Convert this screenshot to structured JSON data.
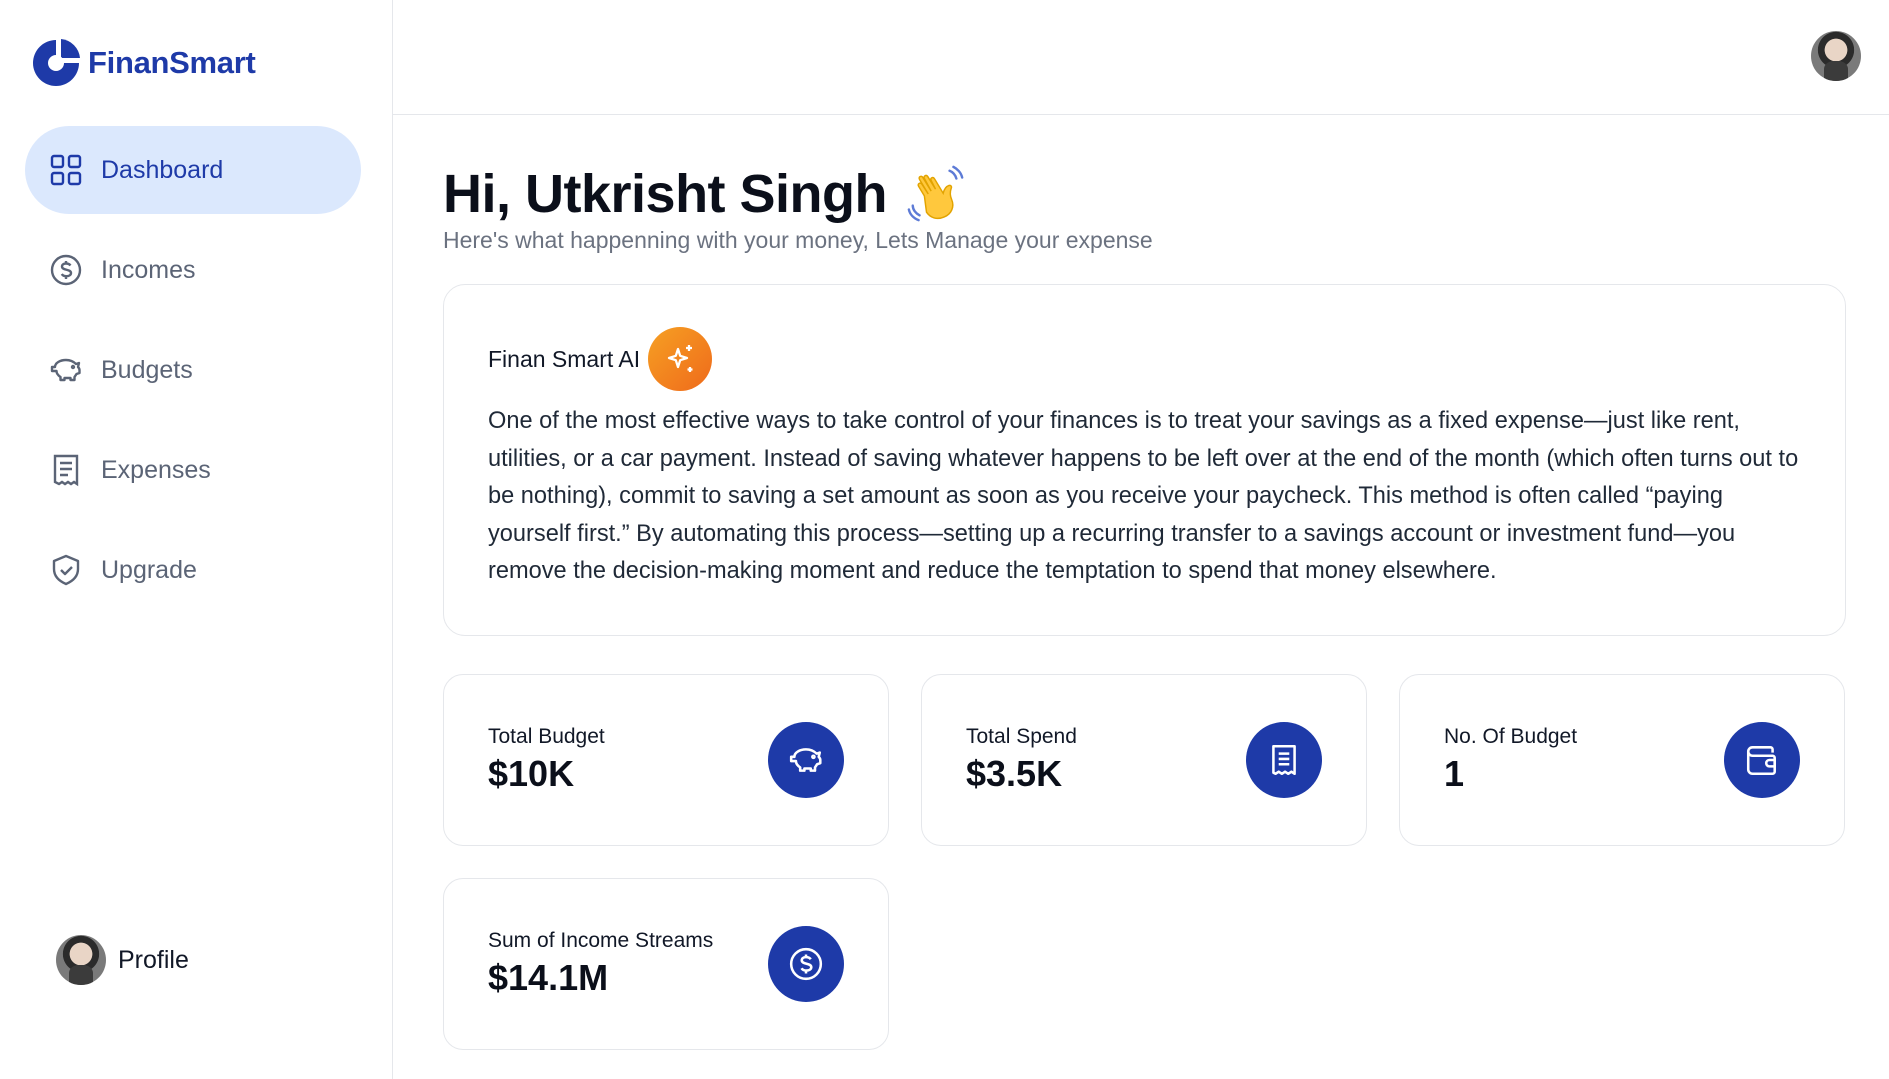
{
  "brand": {
    "name": "FinanSmart",
    "color": "#1e3aa8"
  },
  "sidebar": {
    "items": [
      {
        "label": "Dashboard",
        "icon": "grid-icon",
        "active": true
      },
      {
        "label": "Incomes",
        "icon": "dollar-circle-icon"
      },
      {
        "label": "Budgets",
        "icon": "piggy-bank-icon"
      },
      {
        "label": "Expenses",
        "icon": "receipt-icon"
      },
      {
        "label": "Upgrade",
        "icon": "shield-check-icon"
      }
    ],
    "profile_label": "Profile"
  },
  "main": {
    "greeting": "Hi, Utkrisht Singh",
    "subtitle": "Here's what happenning with your money, Lets Manage your expense",
    "ai": {
      "title": "Finan Smart AI",
      "text": "One of the most effective ways to take control of your finances is to treat your savings as a fixed expense—just like rent, utilities, or a car payment. Instead of saving whatever happens to be left over at the end of the month (which often turns out to be nothing), commit to saving a set amount as soon as you receive your paycheck. This method is often called “paying yourself first.” By automating this process—setting up a recurring transfer to a savings account or investment fund—you remove the decision-making moment and reduce the temptation to spend that money elsewhere."
    },
    "stats": [
      {
        "label": "Total Budget",
        "value": "$10K",
        "icon": "piggy-bank-icon"
      },
      {
        "label": "Total Spend",
        "value": "$3.5K",
        "icon": "receipt-icon"
      },
      {
        "label": "No. Of Budget",
        "value": "1",
        "icon": "wallet-icon"
      },
      {
        "label": "Sum of Income Streams",
        "value": "$14.1M",
        "icon": "dollar-circle-icon"
      }
    ]
  },
  "colors": {
    "accent": "#1e3aa8",
    "active_bg": "#dbe8fd",
    "ai_badge": "#f28a20"
  }
}
